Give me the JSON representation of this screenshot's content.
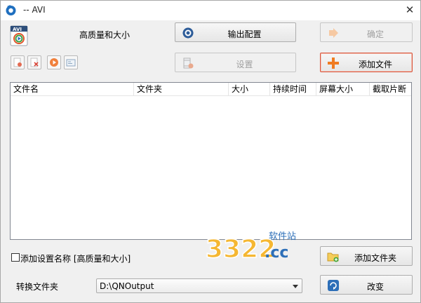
{
  "window": {
    "title": "-- AVI"
  },
  "profile": {
    "name": "高质量和大小"
  },
  "buttons": {
    "output_config": "输出配置",
    "confirm": "确定",
    "settings": "设置",
    "add_file": "添加文件",
    "add_folder": "添加文件夹",
    "change": "改变"
  },
  "file_table": {
    "columns": [
      "文件名",
      "文件夹",
      "大小",
      "持续时间",
      "屏幕大小",
      "截取片断"
    ],
    "rows": []
  },
  "options": {
    "add_setting_name_label": "添加设置名称 [高质量和大小]",
    "add_setting_name_checked": false
  },
  "output": {
    "folder_label": "转换文件夹",
    "folder_path": "D:\\QNOutput"
  },
  "watermark": {
    "big": "3322",
    "dot": ".cc",
    "sub": "软件站"
  },
  "colors": {
    "accent_orange": "#f07c22",
    "primary_border": "#d9533a",
    "blue_icon": "#1f6fbf"
  }
}
